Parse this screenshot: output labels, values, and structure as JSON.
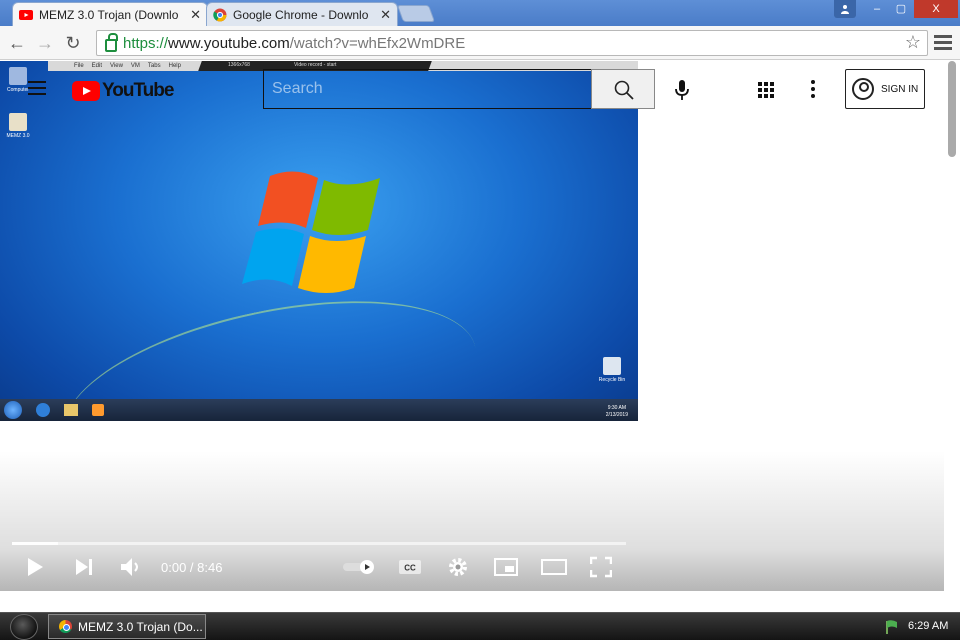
{
  "browser": {
    "tabs": [
      {
        "label": "MEMZ 3.0 Trojan (Downlo",
        "close": "✕",
        "active": true
      },
      {
        "label": "Google Chrome - Downlo",
        "close": "✕",
        "active": false
      }
    ],
    "window_controls": {
      "minimize": "–",
      "restore": "▢",
      "close": "X"
    },
    "address": {
      "scheme": "https://",
      "host": "www.youtube.com",
      "rest": "/watch?v=whEfx2WmDRE"
    },
    "nav": {
      "back": "←",
      "forward": "→",
      "reload": "↻",
      "star": "☆"
    }
  },
  "youtube": {
    "logo_text": "YouTube",
    "search_placeholder": "Search",
    "signin_label": "SIGN IN"
  },
  "player": {
    "time": "0:00 / 8:46",
    "buffered_fraction": 0.075
  },
  "video_frame": {
    "desktop_icons": [
      "Computer",
      "MEMZ 3.0",
      "Recycle Bin"
    ],
    "vm_menu": [
      "File",
      "Edit",
      "View",
      "VM",
      "Tabs",
      "Help"
    ],
    "rec_text": "1366x768",
    "rec_title": "Video record - start",
    "clock": "9:30 AM",
    "date": "2/13/2019"
  },
  "taskbar": {
    "item_label": "MEMZ 3.0 Trojan (Do...",
    "clock": "6:29 AM"
  },
  "colors": {
    "titlebar": "#4a7cc8",
    "youtube_red": "#ff0000",
    "secure_green": "#1e8e3e"
  }
}
